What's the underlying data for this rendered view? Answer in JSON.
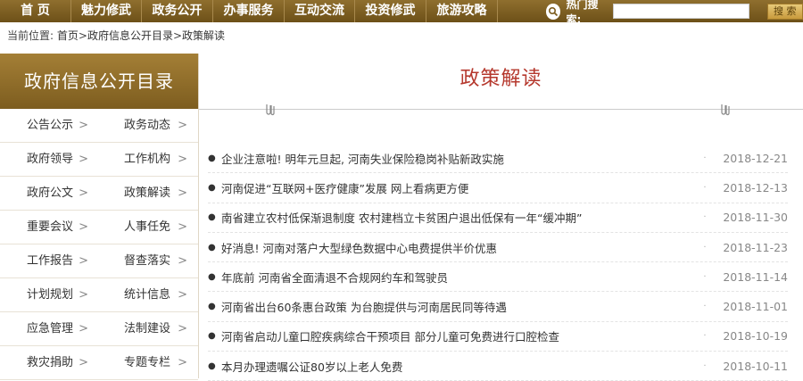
{
  "nav": {
    "items": [
      {
        "label": "首 页"
      },
      {
        "label": "魅力修武"
      },
      {
        "label": "政务公开"
      },
      {
        "label": "办事服务"
      },
      {
        "label": "互动交流"
      },
      {
        "label": "投资修武"
      },
      {
        "label": "旅游攻略"
      }
    ],
    "search_label": "热门搜索:",
    "search_value": "",
    "search_button": "搜 索"
  },
  "breadcrumb": {
    "prefix": "当前位置:",
    "home": "首页",
    "sep1": ">",
    "level1": "政府信息公开目录",
    "sep2": ">",
    "level2": "政策解读"
  },
  "sidebar": {
    "title": "政府信息公开目录",
    "items": [
      {
        "label": "公告公示"
      },
      {
        "label": "政务动态"
      },
      {
        "label": "政府领导"
      },
      {
        "label": "工作机构"
      },
      {
        "label": "政府公文"
      },
      {
        "label": "政策解读"
      },
      {
        "label": "重要会议"
      },
      {
        "label": "人事任免"
      },
      {
        "label": "工作报告"
      },
      {
        "label": "督查落实"
      },
      {
        "label": "计划规划"
      },
      {
        "label": "统计信息"
      },
      {
        "label": "应急管理"
      },
      {
        "label": "法制建设"
      },
      {
        "label": "救灾捐助"
      },
      {
        "label": "专题专栏"
      }
    ],
    "chevron": ">"
  },
  "main": {
    "title": "政策解读",
    "rows": [
      {
        "title": "企业注意啦! 明年元旦起, 河南失业保险稳岗补贴新政实施",
        "date": "2018-12-21"
      },
      {
        "title": "河南促进“互联网+医疗健康”发展 网上看病更方便",
        "date": "2018-12-13"
      },
      {
        "title": "南省建立农村低保渐退制度 农村建档立卡贫困户退出低保有一年“缓冲期”",
        "date": "2018-11-30"
      },
      {
        "title": "好消息! 河南对落户大型绿色数据中心电费提供半价优惠",
        "date": "2018-11-23"
      },
      {
        "title": "年底前 河南省全面清退不合规网约车和驾驶员",
        "date": "2018-11-14"
      },
      {
        "title": "河南省出台60条惠台政策 为台胞提供与河南居民同等待遇",
        "date": "2018-11-01"
      },
      {
        "title": "河南省启动儿童口腔疾病综合干预项目 部分儿童可免费进行口腔检查",
        "date": "2018-10-19"
      },
      {
        "title": "本月办理遗嘱公证80岁以上老人免费",
        "date": "2018-10-11"
      }
    ]
  },
  "colors": {
    "nav_bg": "#7d5d1f",
    "title_red": "#b5382d"
  }
}
